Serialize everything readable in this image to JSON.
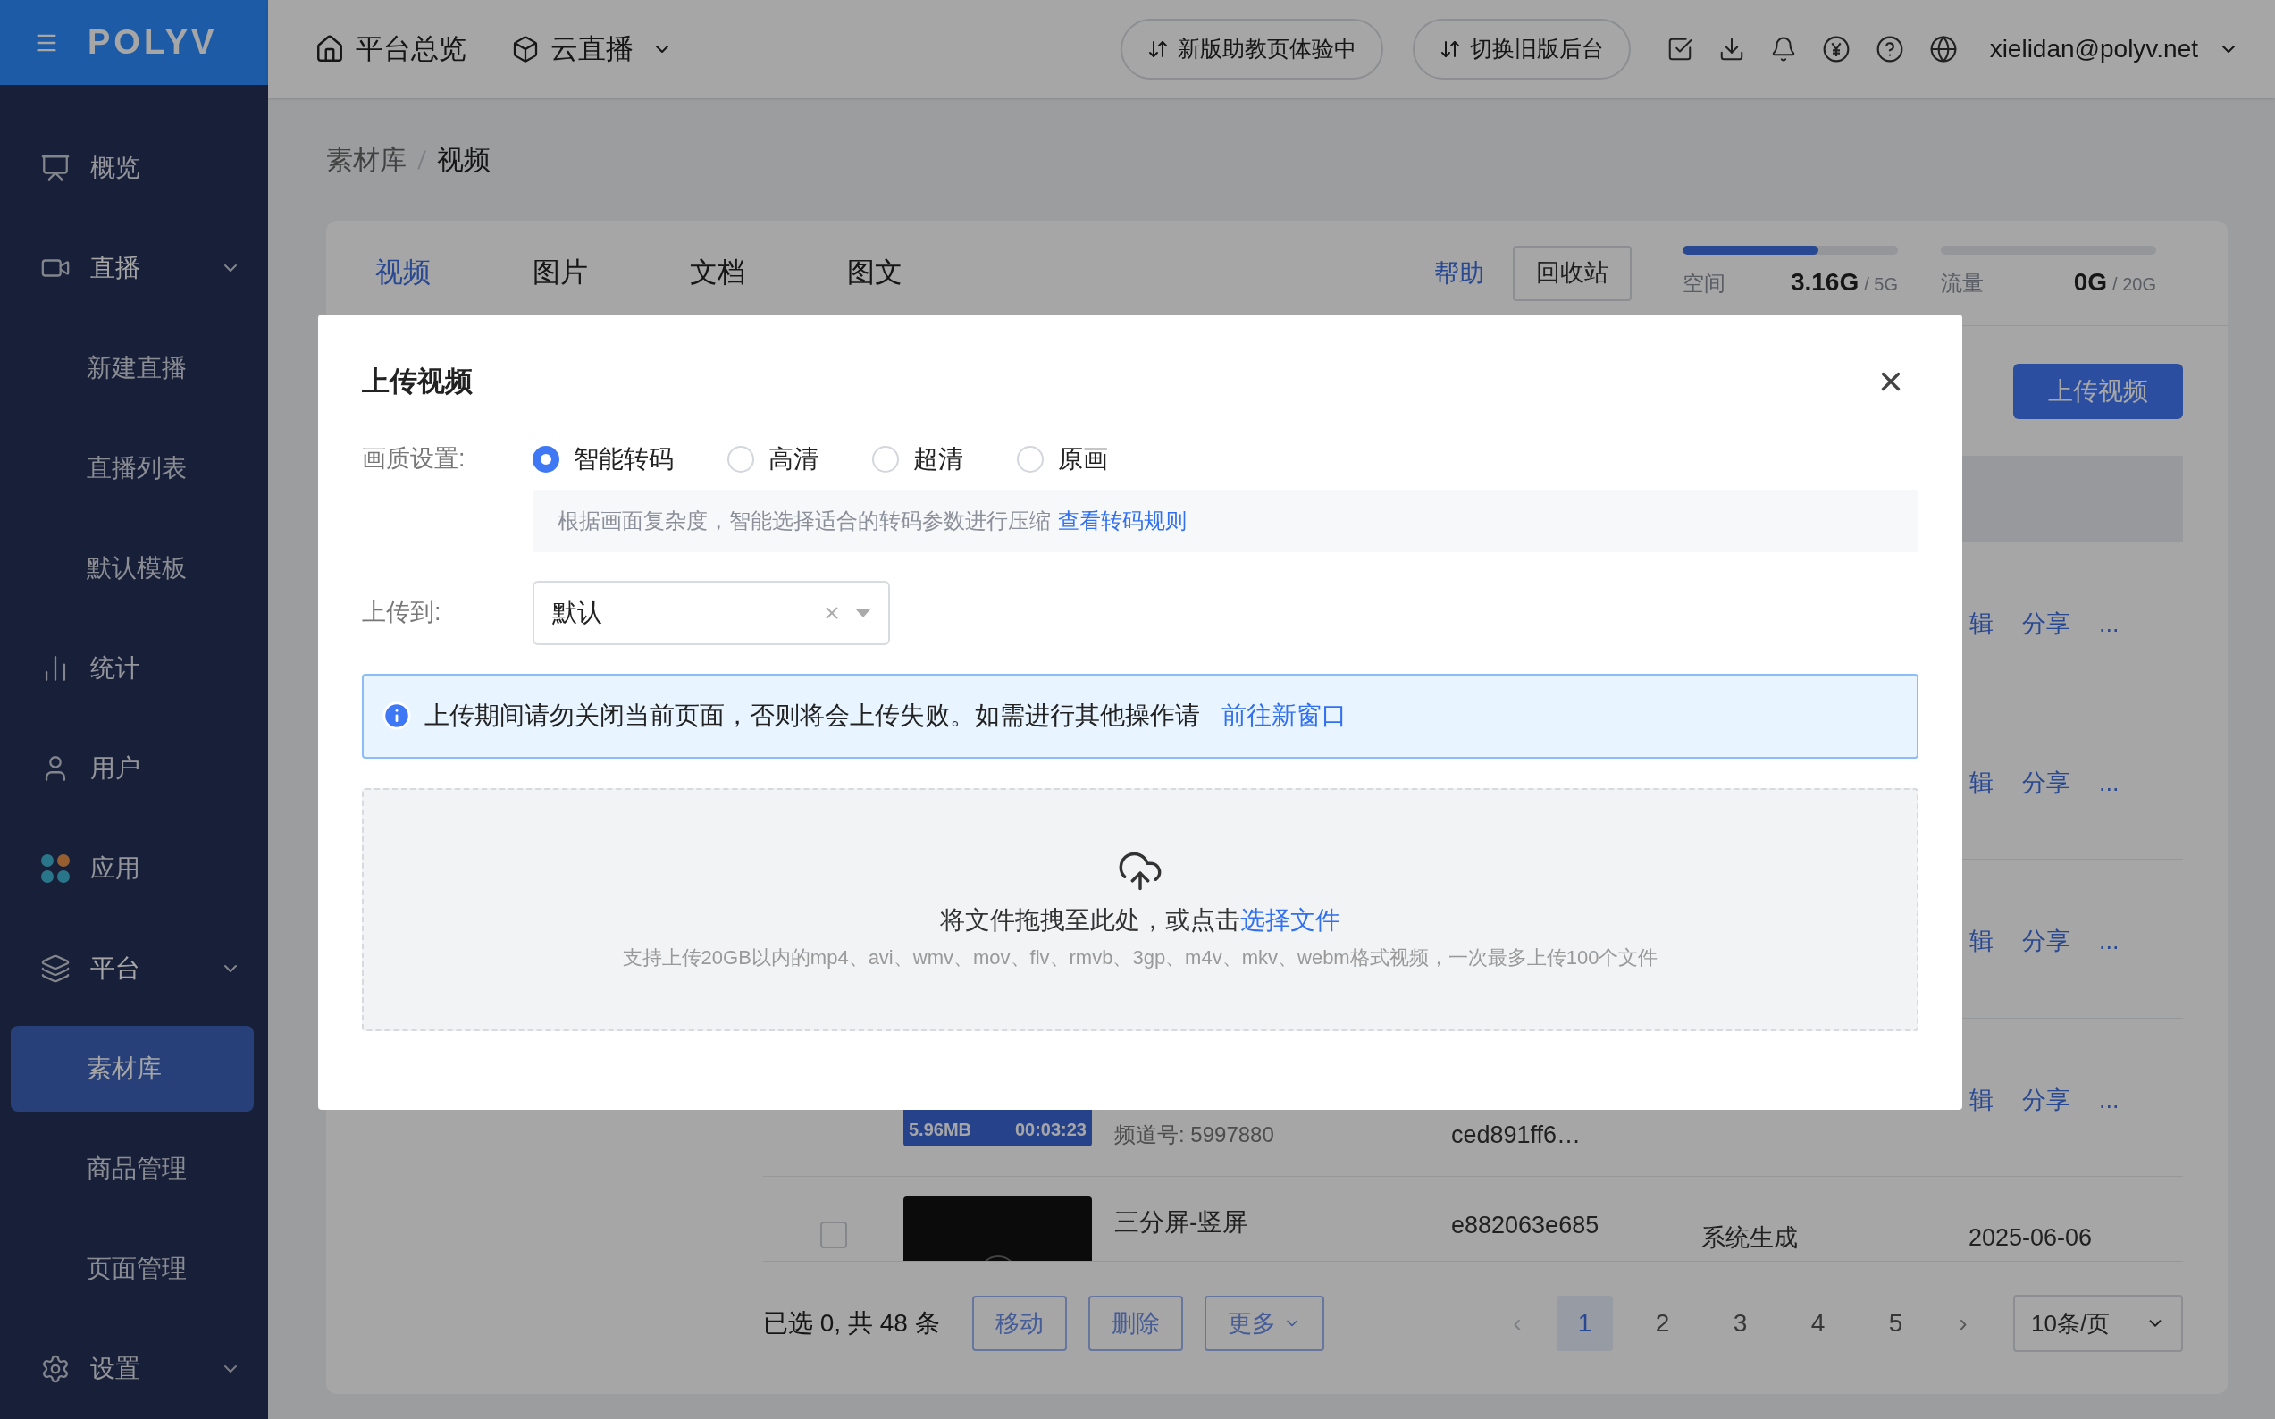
{
  "sidebar": {
    "logo": "POLYV",
    "items": [
      {
        "label": "概览",
        "selected": false
      },
      {
        "label": "直播",
        "selected": false,
        "expanded": true,
        "children": [
          {
            "label": "新建直播",
            "selected": false
          },
          {
            "label": "直播列表",
            "selected": false
          },
          {
            "label": "默认模板",
            "selected": false
          }
        ]
      },
      {
        "label": "统计",
        "selected": false
      },
      {
        "label": "用户",
        "selected": false
      },
      {
        "label": "应用",
        "selected": false
      },
      {
        "label": "平台",
        "selected": false,
        "expanded": true,
        "children": [
          {
            "label": "素材库",
            "selected": true
          },
          {
            "label": "商品管理",
            "selected": false
          },
          {
            "label": "页面管理",
            "selected": false
          }
        ]
      },
      {
        "label": "设置",
        "selected": false,
        "expanded": false
      }
    ]
  },
  "top_bar": {
    "links": [
      "平台总览",
      "云直播"
    ],
    "buttons": [
      "新版助教页体验中",
      "切换旧版后台"
    ],
    "user": "xielidan@polyv.net"
  },
  "breadcrumb": [
    "素材库",
    "视频"
  ],
  "tabs": [
    {
      "label": "视频",
      "selected": true
    },
    {
      "label": "图片",
      "selected": false
    },
    {
      "label": "文档",
      "selected": false
    },
    {
      "label": "图文",
      "selected": false
    }
  ],
  "help_link": "帮助",
  "recycle_button": "回收站",
  "quotas": [
    {
      "label": "空间",
      "level": 0.63,
      "used": "3.16G",
      "total": "/ 5G"
    },
    {
      "label": "流量",
      "level": 0,
      "used": "0G",
      "total": "/ 20G"
    }
  ],
  "upload_button": "上传视频",
  "rows": [
    {
      "actions": [
        "辑",
        "分享",
        "..."
      ]
    },
    {
      "actions": [
        "辑",
        "分享",
        "..."
      ]
    },
    {
      "actions": [
        "辑",
        "分享",
        "..."
      ]
    },
    {
      "size": "5.96MB",
      "duration": "00:03:23",
      "channel": "频道号: 5997880",
      "id": "ced891ff6…",
      "actions": [
        "辑",
        "分享",
        "..."
      ]
    },
    {
      "checked": false,
      "title": "三分屏-竖屏",
      "id": "e882063e685",
      "source": "系统生成",
      "date": "2025-06-06"
    }
  ],
  "footer": {
    "summary": "已选 0, 共 48 条",
    "buttons": [
      "移动",
      "删除",
      "更多"
    ],
    "prev": "‹",
    "next": "›",
    "pages": [
      {
        "label": "1",
        "selected": true
      },
      {
        "label": "2",
        "selected": false
      },
      {
        "label": "3",
        "selected": false
      },
      {
        "label": "4",
        "selected": false
      },
      {
        "label": "5",
        "selected": false
      }
    ],
    "page_size": "10条/页"
  },
  "modal": {
    "title": "上传视频",
    "quality_label": "画质设置:",
    "quality_options": [
      {
        "label": "智能转码",
        "selected": true
      },
      {
        "label": "高清",
        "selected": false
      },
      {
        "label": "超清",
        "selected": false
      },
      {
        "label": "原画",
        "selected": false
      }
    ],
    "quality_hint": "根据画面复杂度，智能选择适合的转码参数进行压缩",
    "quality_hint_link": "查看转码规则",
    "upload_to_label": "上传到:",
    "upload_to_value": "默认",
    "notice": "上传期间请勿关闭当前页面，否则将会上传失败。如需进行其他操作请",
    "notice_link": "前往新窗口",
    "drop_text": "将文件拖拽至此处，或点击",
    "drop_link": "选择文件",
    "drop_hint": "支持上传20GB以内的mp4、avi、wmv、mov、flv、rmvb、3gp、m4v、mkv、webm格式视频，一次最多上传100个文件"
  }
}
